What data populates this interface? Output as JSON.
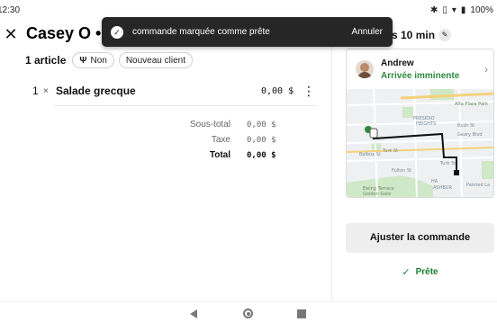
{
  "status_bar": {
    "time": "12:30",
    "icons": [
      "bluetooth-icon",
      "vibrate-icon",
      "wifi-icon",
      "battery-icon"
    ],
    "battery_text": "100%"
  },
  "header": {
    "close_icon": "close-icon",
    "title": "Casey O • 0"
  },
  "order_meta": {
    "item_count": "1 article",
    "utensils_label": "Non",
    "customer_badge": "Nouveau client"
  },
  "items": [
    {
      "qty": "1",
      "multiplier": "×",
      "name": "Salade grecque",
      "price": "0,00 $"
    }
  ],
  "totals": [
    {
      "label": "Sous-total",
      "value": "0,00 $"
    },
    {
      "label": "Taxe",
      "value": "0,00 $"
    },
    {
      "label": "Total",
      "value": "0,00 $"
    }
  ],
  "eta": {
    "text": "s 10 min"
  },
  "courier": {
    "name": "Andrew",
    "status": "Arrivée imminente"
  },
  "map": {
    "labels": [
      "PRESIDIO",
      "HEIGHTS",
      "Alta Plaza Park",
      "Bush St",
      "Geary Blvd",
      "Turk St",
      "Balboa St",
      "Fulton St",
      "Ewing Terrace",
      "Golden Gate",
      "Painted La",
      "HA",
      "ASHBUR"
    ]
  },
  "actions": {
    "adjust_label": "Ajuster la commande",
    "ready_label": "Prête"
  },
  "toast": {
    "message": "commande marquée comme prête",
    "undo_label": "Annuler"
  },
  "colors": {
    "accent_green": "#2e8b3e",
    "toast_bg": "#262626",
    "route": "#111111"
  }
}
